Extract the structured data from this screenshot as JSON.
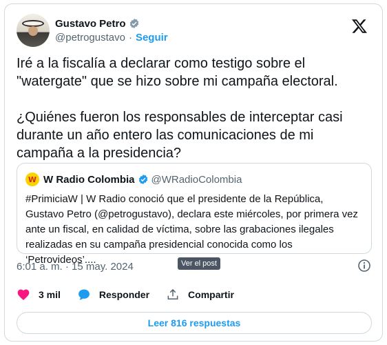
{
  "author": {
    "name": "Gustavo Petro",
    "handle": "@petrogustavo",
    "separator": "·",
    "follow_label": "Seguir"
  },
  "tweet": {
    "text": "Iré a la fiscalía a declarar como testigo sobre el \"watergate\" que se hizo sobre mi campaña electoral.\n\n¿Quiénes fueron los responsables de interceptar casi durante un año entero las comunicaciones de mi campaña a la presidencia?"
  },
  "quoted": {
    "avatar_text": "W",
    "name": "W Radio Colombia",
    "handle": "@WRadioColombia",
    "text": "#PrimiciaW | W Radio conoció que el presidente de la República, Gustavo Petro (@petrogustavo), declara este miércoles, por primera vez ante un fiscal, en calidad de víctima, sobre las grabaciones ilegales realizadas en su campaña presidencial conocida como los ‘Petrovideos’...."
  },
  "meta": {
    "timestamp": "6:01 a. m. · 15 may. 2024",
    "tooltip": "Ver el post"
  },
  "actions": {
    "likes": "3 mil",
    "reply_label": "Responder",
    "share_label": "Compartir"
  },
  "replies_button": "Leer 816 respuestas",
  "colors": {
    "accent": "#1d9bf0",
    "like": "#f91880",
    "text": "#0f1419",
    "secondary": "#536471",
    "border": "#cfd9de"
  },
  "icons": [
    "verified-icon",
    "x-logo-icon",
    "info-icon",
    "heart-icon",
    "reply-icon",
    "share-icon"
  ]
}
